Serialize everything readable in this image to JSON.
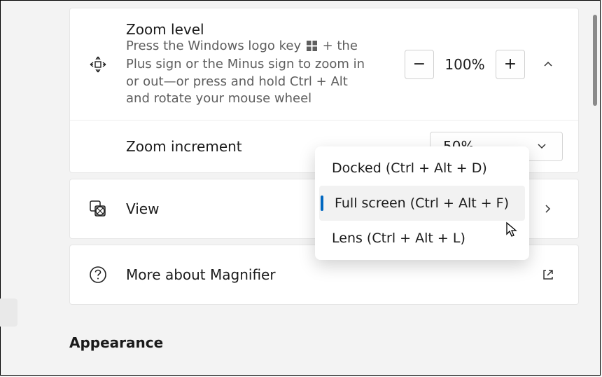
{
  "zoom": {
    "title": "Zoom level",
    "desc_before": "Press the Windows logo key ",
    "desc_after": " + the Plus sign or the Minus sign to zoom in or out—or press and hold Ctrl + Alt and rotate your mouse wheel",
    "value": "100%",
    "minus": "−",
    "plus": "+"
  },
  "increment": {
    "title": "Zoom increment",
    "value": "50%"
  },
  "view": {
    "title": "View",
    "options": [
      {
        "label": "Docked (Ctrl + Alt + D)"
      },
      {
        "label": "Full screen (Ctrl + Alt + F)"
      },
      {
        "label": "Lens (Ctrl + Alt + L)"
      }
    ]
  },
  "more": {
    "title": "More about Magnifier"
  },
  "section": {
    "heading": "Appearance"
  }
}
